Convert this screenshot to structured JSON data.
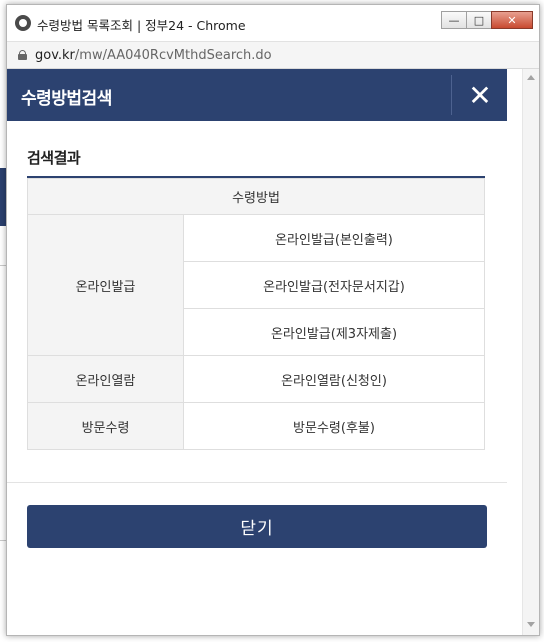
{
  "window": {
    "title": "수령방법 목록조회 | 정부24 - Chrome",
    "buttons": {
      "minimize": "—",
      "restore": "□",
      "close": "✕"
    }
  },
  "address_bar": {
    "host": "gov.kr",
    "path": "/mw/AA040RcvMthdSearch.do"
  },
  "dialog": {
    "title": "수령방법검색",
    "close_icon": "✕",
    "section_title": "검색결과",
    "table": {
      "header": "수령방법",
      "groups": [
        {
          "category": "온라인발급",
          "items": [
            "온라인발급(본인출력)",
            "온라인발급(전자문서지갑)",
            "온라인발급(제3자제출)"
          ]
        },
        {
          "category": "온라인열람",
          "items": [
            "온라인열람(신청인)"
          ]
        },
        {
          "category": "방문수령",
          "items": [
            "방문수령(후불)"
          ]
        }
      ]
    },
    "close_button_label": "닫기"
  },
  "colors": {
    "header_bg": "#2c4270",
    "button_bg": "#2c4270",
    "table_header_bg": "#f4f4f4",
    "border": "#dedede"
  }
}
